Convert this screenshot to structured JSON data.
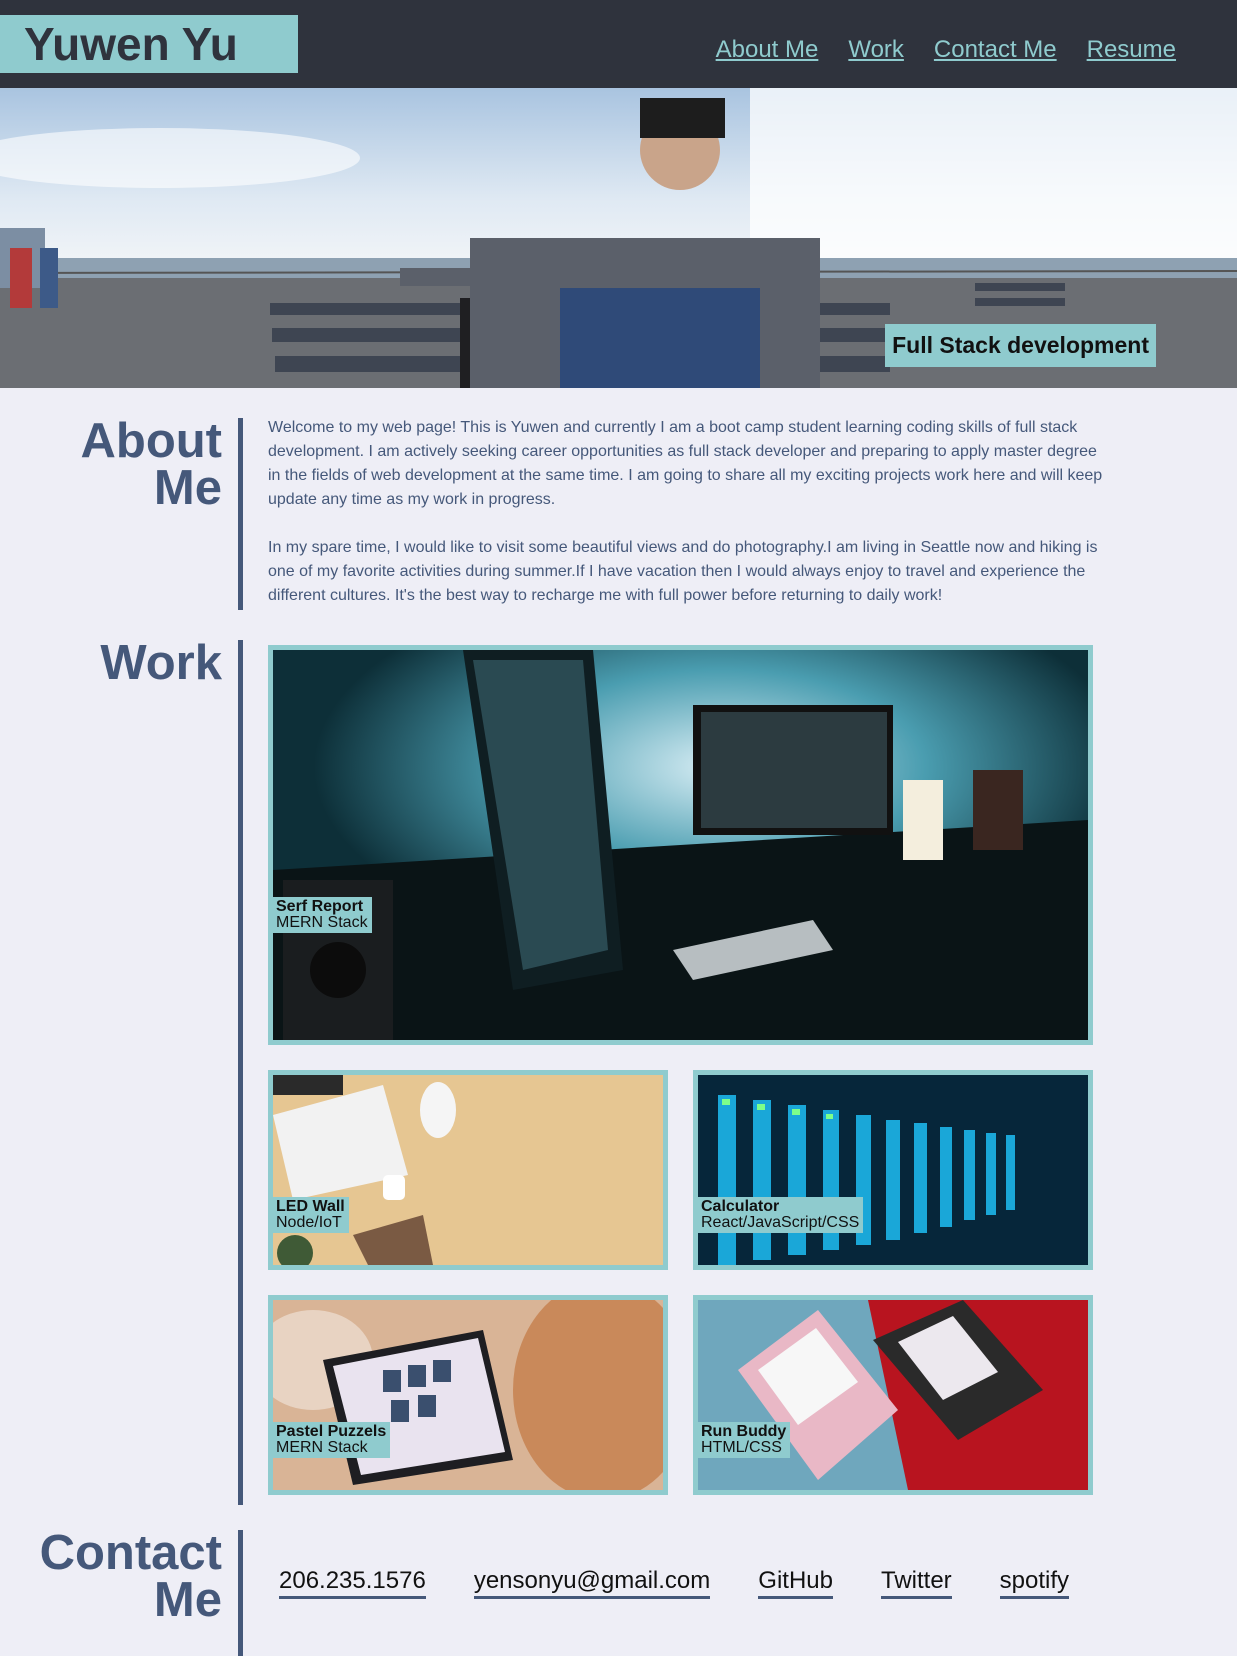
{
  "header": {
    "logo": "Yuwen Yu",
    "nav": [
      "About Me",
      "Work",
      "Contact Me",
      "Resume"
    ]
  },
  "hero": {
    "tagline": "Full Stack development"
  },
  "about": {
    "heading_line1": "About",
    "heading_line2": "Me",
    "paragraphs": [
      "Welcome to my web page! This is Yuwen and currently I am a boot camp student learning coding skills of full stack development. I am actively seeking career opportunities as full stack developer and preparing to apply master degree in the fields of web development at the same time. I am going to share all my exciting projects work here and will keep update any time as my work in progress.",
      "In my spare time, I would like to visit some beautiful views and do photography.I am living in Seattle now and hiking is one of my favorite activities during summer.If I have vacation then I would always enjoy to travel and experience the different cultures. It's the best way to recharge me with full power before returning to daily work!"
    ]
  },
  "work": {
    "heading": "Work",
    "projects": [
      {
        "title": "Serf Report",
        "stack": "MERN Stack"
      },
      {
        "title": "LED Wall",
        "stack": "Node/IoT"
      },
      {
        "title": "Calculator",
        "stack": "React/JavaScript/CSS"
      },
      {
        "title": "Pastel Puzzels",
        "stack": "MERN Stack"
      },
      {
        "title": "Run Buddy",
        "stack": "HTML/CSS"
      }
    ]
  },
  "contact": {
    "heading_line1": "Contact",
    "heading_line2": "Me",
    "links": [
      "206.235.1576",
      "yensonyu@gmail.com",
      "GitHub",
      "Twitter",
      "spotify"
    ]
  },
  "colors": {
    "header_bg": "#2f333d",
    "accent": "#8fcbce",
    "heading": "#45587a",
    "page_bg": "#eeeef6"
  }
}
